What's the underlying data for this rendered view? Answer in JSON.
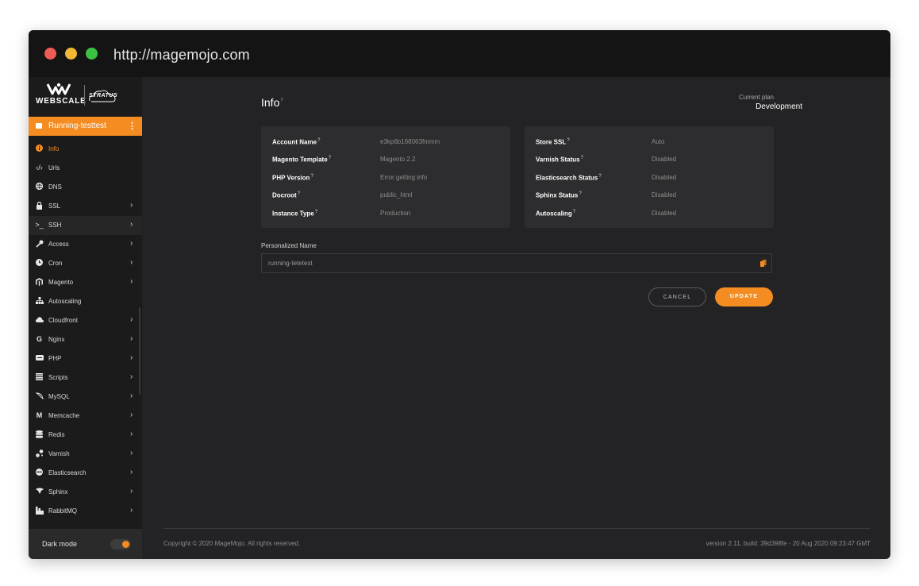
{
  "browser": {
    "url": "http://magemojo.com"
  },
  "brand": {
    "name": "WEBSCALE",
    "product": "STRATUS"
  },
  "environment": {
    "label": "Running-testtest"
  },
  "sidebar": {
    "items": [
      {
        "label": "Info",
        "icon": "info-icon"
      },
      {
        "label": "Urls",
        "icon": "code-icon"
      },
      {
        "label": "DNS",
        "icon": "globe-icon"
      },
      {
        "label": "SSL",
        "icon": "lock-icon"
      },
      {
        "label": "SSH",
        "icon": "terminal-icon"
      },
      {
        "label": "Access",
        "icon": "key-icon"
      },
      {
        "label": "Cron",
        "icon": "clock-icon"
      },
      {
        "label": "Magento",
        "icon": "magento-icon"
      },
      {
        "label": "Autoscaling",
        "icon": "hierarchy-icon"
      },
      {
        "label": "Cloudfront",
        "icon": "cloud-icon"
      },
      {
        "label": "Nginx",
        "icon": "nginx-icon"
      },
      {
        "label": "PHP",
        "icon": "php-icon"
      },
      {
        "label": "Scripts",
        "icon": "list-icon"
      },
      {
        "label": "MySQL",
        "icon": "dolphin-icon"
      },
      {
        "label": "Memcache",
        "icon": "memcache-icon"
      },
      {
        "label": "Redis",
        "icon": "database-icon"
      },
      {
        "label": "Varnish",
        "icon": "varnish-icon"
      },
      {
        "label": "Elasticsearch",
        "icon": "elastic-icon"
      },
      {
        "label": "Sphinx",
        "icon": "sphinx-icon"
      },
      {
        "label": "RabbitMQ",
        "icon": "rabbit-icon"
      }
    ],
    "dark_mode_label": "Dark mode"
  },
  "info": {
    "title": "Info",
    "plan_caption": "Current plan",
    "plan_value": "Development",
    "left_card": [
      {
        "label": "Account Name",
        "value": "e3kp6b168063fmmm"
      },
      {
        "label": "Magento Template",
        "value": "Magento 2.2"
      },
      {
        "label": "PHP Version",
        "value": "Error getting info"
      },
      {
        "label": "Docroot",
        "value": "public_html"
      },
      {
        "label": "Instance Type",
        "value": "Production"
      }
    ],
    "right_card": [
      {
        "label": "Store SSL",
        "value": "Auto"
      },
      {
        "label": "Varnish Status",
        "value": "Disabled"
      },
      {
        "label": "Elasticsearch Status",
        "value": "Disabled"
      },
      {
        "label": "Sphinx Status",
        "value": "Disabled"
      },
      {
        "label": "Autoscaling",
        "value": "Disabled"
      }
    ],
    "personalized_label": "Personalized Name",
    "personalized_value": "running-tetetest",
    "cancel_label": "CANCEL",
    "update_label": "UPDATE"
  },
  "footer": {
    "copyright": "Copyright © 2020 MageMojo. All rights reserved.",
    "version": "version 2.11, build: 39d398fe - 20 Aug 2020 09:23:47 GMT"
  },
  "colors": {
    "accent": "#f48c21",
    "background": "#232224",
    "card": "#2d2c2e",
    "sidebar": "#1b1b1c"
  }
}
